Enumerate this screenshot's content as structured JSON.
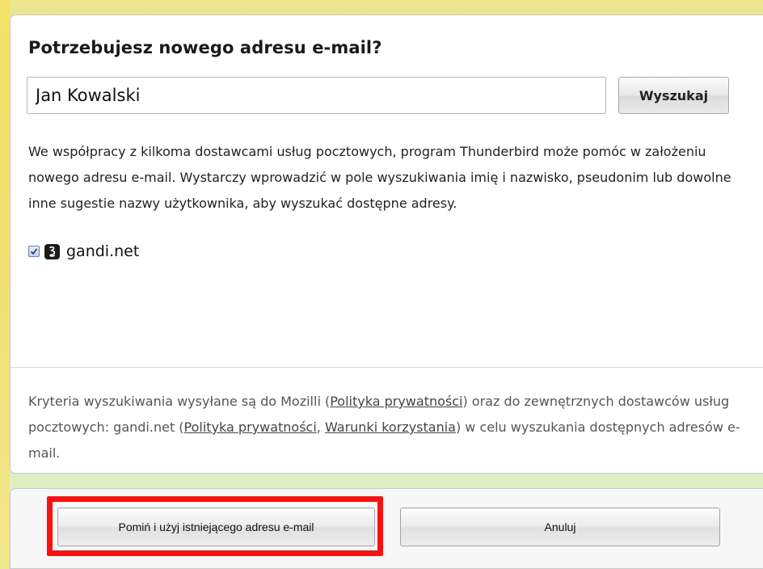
{
  "dialog": {
    "heading": "Potrzebujesz nowego adresu e-mail?",
    "search_value": "Jan Kowalski",
    "search_button": "Wyszukaj",
    "description": "We współpracy z kilkoma dostawcami usług pocztowych, program Thunderbird może pomóc w założeniu nowego adresu e-mail. Wystarczy wprowadzić w pole wyszukiwania imię i nazwisko, pseudonim lub dowolne inne sugestie nazwy użytkownika, aby wyszukać dostępne adresy.",
    "providers": [
      {
        "name": "gandi.net",
        "checked": true,
        "icon": "gandi-logo-icon"
      }
    ],
    "footer": {
      "text_1": "Kryteria wyszukiwania wysyłane są do Mozilli (",
      "privacy_link_1": "Polityka prywatności",
      "text_2": ") oraz do zewnętrznych dostawców usług pocztowych: gandi.net (",
      "privacy_link_2": "Polityka prywatności",
      "text_3": ", ",
      "terms_link": "Warunki korzystania",
      "text_4": ") w celu wyszukania dostępnych adresów e-mail."
    }
  },
  "buttons": {
    "skip": "Pomiń i użyj istniejącego adresu e-mail",
    "cancel": "Anuluj"
  },
  "colors": {
    "highlight": "#ff1010",
    "background_yellow": "#efe58a",
    "background_green": "#dcefc6"
  }
}
